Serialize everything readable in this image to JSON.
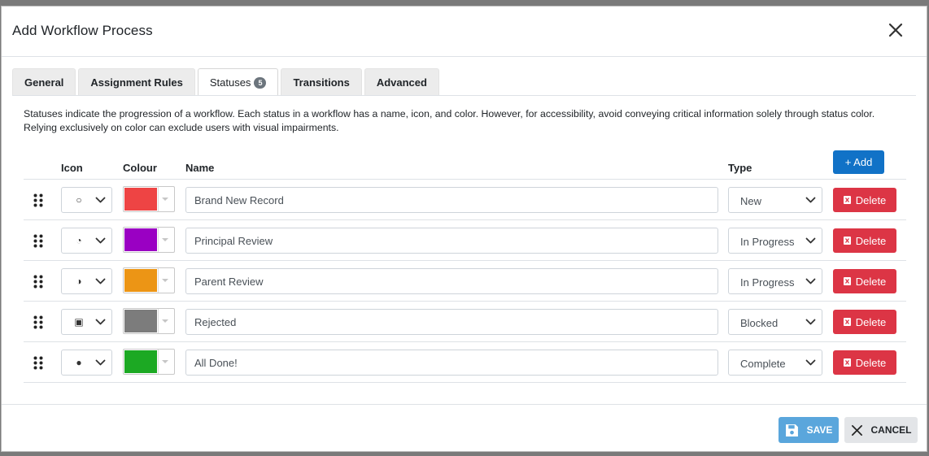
{
  "dialog": {
    "title": "Add Workflow Process"
  },
  "tabs": [
    {
      "label": "General"
    },
    {
      "label": "Assignment Rules"
    },
    {
      "label": "Statuses",
      "badge": "5",
      "active": true
    },
    {
      "label": "Transitions"
    },
    {
      "label": "Advanced"
    }
  ],
  "description": "Statuses indicate the progression of a workflow. Each status in a workflow has a name, icon, and color. However, for accessibility, avoid conveying critical information solely through status color. Relying exclusively on color can exclude users with visual impairments.",
  "table": {
    "headers": {
      "icon": "Icon",
      "colour": "Colour",
      "name": "Name",
      "type": "Type"
    },
    "add_label": "+ Add",
    "delete_label": "Delete",
    "rows": [
      {
        "icon": "circle-empty-icon",
        "glyph": "○",
        "color": "#ee4444",
        "name": "Brand New Record",
        "type": "New"
      },
      {
        "icon": "circle-quarter-icon",
        "glyph": "◔",
        "color": "#9a00c3",
        "name": "Principal Review",
        "type": "In Progress"
      },
      {
        "icon": "circle-half-icon",
        "glyph": "◑",
        "color": "#ec9515",
        "name": "Parent Review",
        "type": "In Progress"
      },
      {
        "icon": "square-dot-icon",
        "glyph": "▣",
        "color": "#7c7c7c",
        "name": "Rejected",
        "type": "Blocked"
      },
      {
        "icon": "circle-filled-icon",
        "glyph": "●",
        "color": "#1ca923",
        "name": "All Done!",
        "type": "Complete"
      }
    ]
  },
  "footer": {
    "save_label": "SAVE",
    "cancel_label": "CANCEL"
  },
  "colors": {
    "primary": "#1172c7",
    "danger": "#dc3545",
    "save": "#5aa6dc",
    "secondary": "#e3e5e8"
  }
}
